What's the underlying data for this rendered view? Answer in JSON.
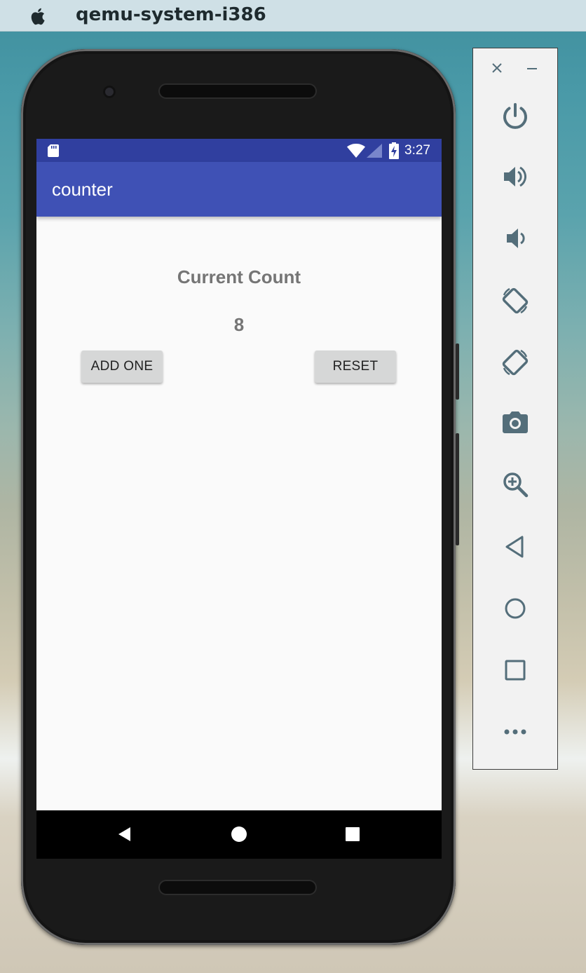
{
  "window": {
    "title": "qemu-system-i386",
    "apple_icon": "apple-logo-icon"
  },
  "device": {
    "status_bar": {
      "time": "3:27",
      "icons": [
        "sd-card-icon",
        "wifi-icon",
        "cell-signal-icon",
        "battery-charging-icon"
      ]
    },
    "app_bar": {
      "title": "counter"
    },
    "content": {
      "label": "Current Count",
      "count": "8",
      "add_button": "ADD ONE",
      "reset_button": "RESET"
    },
    "nav_bar": {
      "icons": [
        "back-icon",
        "home-icon",
        "recents-icon"
      ]
    }
  },
  "emulator_panel": {
    "window_controls": [
      "close-icon",
      "minimize-icon"
    ],
    "buttons": [
      {
        "name": "power-icon"
      },
      {
        "name": "volume-up-icon"
      },
      {
        "name": "volume-down-icon"
      },
      {
        "name": "rotate-left-icon"
      },
      {
        "name": "rotate-right-icon"
      },
      {
        "name": "camera-icon"
      },
      {
        "name": "zoom-icon"
      },
      {
        "name": "back-icon"
      },
      {
        "name": "home-icon"
      },
      {
        "name": "overview-icon"
      },
      {
        "name": "more-icon"
      }
    ]
  },
  "colors": {
    "status_bar": "#303f9f",
    "app_bar": "#3f51b5",
    "screen_bg": "#fafafa",
    "text_gray": "#757575",
    "button_bg": "#d6d7d7",
    "panel_icon": "#546e7a"
  }
}
